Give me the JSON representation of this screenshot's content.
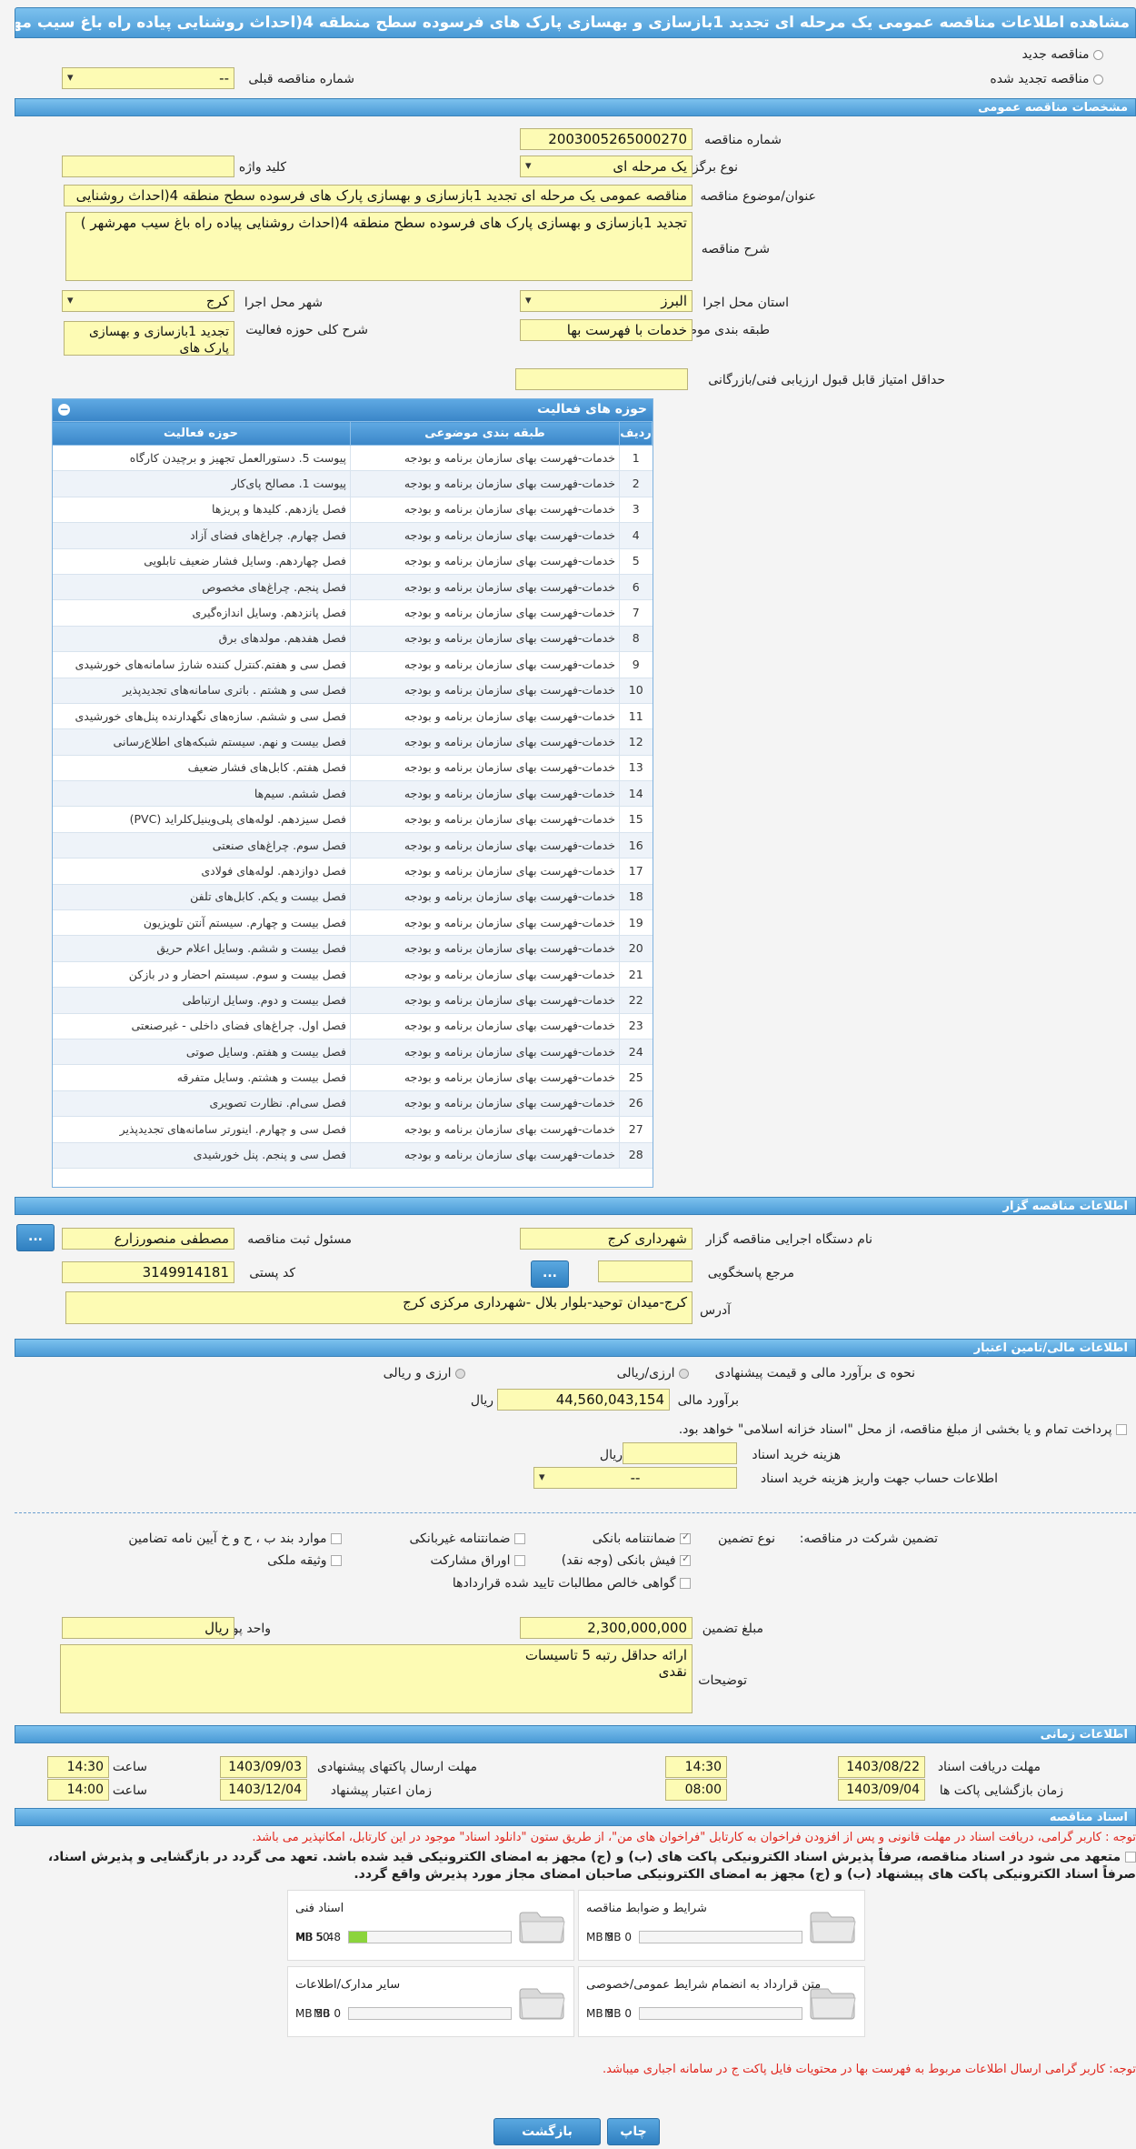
{
  "header": {
    "title": "مشاهده اطلاعات مناقصه عمومی یک مرحله ای تجدید 1بازسازی و بهسازی پارک های فرسوده سطح منطقه 4(احداث روشنایی پیاده راه باغ سیب مهرشهر )"
  },
  "top": {
    "new_tender": "مناقصه جدید",
    "renewed_tender": "مناقصه تجدید شده",
    "prev_number_label": "شماره مناقصه قبلی",
    "prev_number_value": "--"
  },
  "general": {
    "section_title": "مشخصات مناقصه عمومی",
    "number_label": "شماره مناقصه",
    "number_value": "2003005265000270",
    "type_label": "نوع برگزاری",
    "type_value": "یک مرحله ای",
    "keyword_label": "کلید واژه",
    "keyword_value": "",
    "subject_label": "عنوان/موضوع مناقصه",
    "subject_value": "مناقصه عمومی یک مرحله ای تجدید 1بازسازی و بهسازی پارک های فرسوده سطح منطقه 4(احداث روشنایی",
    "desc_label": "شرح مناقصه",
    "desc_value": "تجدید 1بازسازی و بهسازی پارک های فرسوده سطح منطقه 4(احداث روشنایی پیاده راه باغ سیب مهرشهر )",
    "province_label": "استان محل اجرا",
    "province_value": "البرز",
    "city_label": "شهر محل اجرا",
    "city_value": "کرج",
    "category_label": "طبقه بندی موضوعی",
    "category_value": "خدمات با فهرست بها",
    "activity_desc_label": "شرح کلی حوزه فعالیت",
    "activity_desc_value": "تجدید 1بازسازی و بهسازی پارک های",
    "min_score_label": "حداقل امتیاز قابل قبول ارزیابی فنی/بازرگانی",
    "min_score_value": ""
  },
  "activities": {
    "title": "حوزه های فعالیت",
    "headers": [
      "ردیف",
      "طبقه بندی موضوعی",
      "حوزه فعالیت"
    ],
    "rows": [
      [
        "1",
        "خدمات-فهرست بهای سازمان برنامه و بودجه",
        "پیوست 5. دستورالعمل تجهیز و برچیدن کارگاه"
      ],
      [
        "2",
        "خدمات-فهرست بهای سازمان برنامه و بودجه",
        "پیوست 1. مصالح پای‌کار"
      ],
      [
        "3",
        "خدمات-فهرست بهای سازمان برنامه و بودجه",
        "فصل یازدهم. کلیدها و پریزها"
      ],
      [
        "4",
        "خدمات-فهرست بهای سازمان برنامه و بودجه",
        "فصل چهارم. چراغ‌های فضای آزاد"
      ],
      [
        "5",
        "خدمات-فهرست بهای سازمان برنامه و بودجه",
        "فصل چهاردهم. وسایل فشار ضعیف تابلویی"
      ],
      [
        "6",
        "خدمات-فهرست بهای سازمان برنامه و بودجه",
        "فصل پنجم. چراغ‌های مخصوص"
      ],
      [
        "7",
        "خدمات-فهرست بهای سازمان برنامه و بودجه",
        "فصل پانزدهم. وسایل اندازه‌گیری"
      ],
      [
        "8",
        "خدمات-فهرست بهای سازمان برنامه و بودجه",
        "فصل هفدهم. مولدهای برق"
      ],
      [
        "9",
        "خدمات-فهرست بهای سازمان برنامه و بودجه",
        "فصل سی و هفتم.کنترل کننده شارژ سامانه‌های خورشیدی"
      ],
      [
        "10",
        "خدمات-فهرست بهای سازمان برنامه و بودجه",
        "فصل سی و هشتم . باتری سامانه‌های تجدیدپذیر"
      ],
      [
        "11",
        "خدمات-فهرست بهای سازمان برنامه و بودجه",
        "فصل سی و ششم. سازه‌های نگهدارنده پنل‌های خورشیدی"
      ],
      [
        "12",
        "خدمات-فهرست بهای سازمان برنامه و بودجه",
        "فصل بیست و نهم. سیستم شبکه‌های اطلاع‌رسانی"
      ],
      [
        "13",
        "خدمات-فهرست بهای سازمان برنامه و بودجه",
        "فصل هفتم. کابل‌های فشار ضعیف"
      ],
      [
        "14",
        "خدمات-فهرست بهای سازمان برنامه و بودجه",
        "فصل ششم. سیم‌ها"
      ],
      [
        "15",
        "خدمات-فهرست بهای سازمان برنامه و بودجه",
        "فصل سیزدهم. لوله‌های پلی‌وینیل‌کلراید (PVC)"
      ],
      [
        "16",
        "خدمات-فهرست بهای سازمان برنامه و بودجه",
        "فصل سوم. چراغ‌های صنعتی"
      ],
      [
        "17",
        "خدمات-فهرست بهای سازمان برنامه و بودجه",
        "فصل دوازدهم. لوله‌های فولادی"
      ],
      [
        "18",
        "خدمات-فهرست بهای سازمان برنامه و بودجه",
        "فصل بیست و یکم. کابل‌های تلفن"
      ],
      [
        "19",
        "خدمات-فهرست بهای سازمان برنامه و بودجه",
        "فصل بیست و چهارم. سیستم آنتن تلویزیون"
      ],
      [
        "20",
        "خدمات-فهرست بهای سازمان برنامه و بودجه",
        "فصل بیست و ششم. وسایل اعلام حریق"
      ],
      [
        "21",
        "خدمات-فهرست بهای سازمان برنامه و بودجه",
        "فصل بیست و سوم. سیستم احضار و در بازکن"
      ],
      [
        "22",
        "خدمات-فهرست بهای سازمان برنامه و بودجه",
        "فصل بیست و دوم. وسایل ارتباطی"
      ],
      [
        "23",
        "خدمات-فهرست بهای سازمان برنامه و بودجه",
        "فصل اول. چراغ‌های فضای داخلی - غیرصنعتی"
      ],
      [
        "24",
        "خدمات-فهرست بهای سازمان برنامه و بودجه",
        "فصل بیست و هفتم. وسایل صوتی"
      ],
      [
        "25",
        "خدمات-فهرست بهای سازمان برنامه و بودجه",
        "فصل بیست و هشتم. وسایل متفرقه"
      ],
      [
        "26",
        "خدمات-فهرست بهای سازمان برنامه و بودجه",
        "فصل سی‌ام. نظارت تصویری"
      ],
      [
        "27",
        "خدمات-فهرست بهای سازمان برنامه و بودجه",
        "فصل سی و چهارم. اینورتر سامانه‌های تجدیدپذیر"
      ],
      [
        "28",
        "خدمات-فهرست بهای سازمان برنامه و بودجه",
        "فصل سی و پنجم. پنل خورشیدی"
      ]
    ]
  },
  "organizer": {
    "section_title": "اطلاعات مناقصه گزار",
    "org_label": "نام دستگاه اجرایی مناقصه گزار",
    "org_value": "شهرداری کرج",
    "registrar_label": "مسئول ثبت مناقصه",
    "registrar_value": "مصطفی منصورزارع",
    "ref_label": "مرجع پاسخگویی",
    "ref_value": "",
    "postal_label": "کد پستی",
    "postal_value": "3149914181",
    "address_label": "آدرس",
    "address_value": "کرج-میدان توحید-بلوار بلال -شهرداری مرکزی کرج",
    "btn_more": "..."
  },
  "financial": {
    "section_title": "اطلاعات مالی/تامین اعتبار",
    "estimate_method_label": "نحوه ی برآورد مالی و قیمت پیشنهادی",
    "opt_rial_fx": "ارزی/ریالی",
    "opt_fx_and_rial": "ارزی و ریالی",
    "estimate_label": "برآورد مالی",
    "estimate_value": "44,560,043,154",
    "currency": "ریال",
    "islamic_note": "پرداخت تمام و یا بخشی از مبلغ مناقصه، از محل \"اسناد خزانه اسلامی\" خواهد بود.",
    "doc_fee_label": "هزینه خرید اسناد",
    "doc_fee_unit": "ریال",
    "doc_fee_value": "",
    "account_label": "اطلاعات حساب جهت واریز هزینه خرید اسناد",
    "account_value": "--"
  },
  "guarantee": {
    "participation_label": "تضمین شرکت در مناقصه:",
    "type_label": "نوع تضمین",
    "options": {
      "bank_guarantee": "ضمانتنامه بانکی",
      "non_bank_guarantee": "ضمانتنامه غیربانکی",
      "clause_items": "موارد بند ب ، ح و خ آیین نامه تضامین",
      "bank_receipt": "فیش بانکی (وجه نقد)",
      "bonds": "اوراق مشارکت",
      "property": "وثیقه ملکی",
      "receivables": "گواهی خالص مطالبات تایید شده قراردادها"
    },
    "amount_label": "مبلغ تضمین",
    "amount_value": "2,300,000,000",
    "currency_label": "واحد پول",
    "currency_value": "ریال",
    "notes_label": "توضیحات",
    "notes_value": "ارائه حداقل رتبه 5 تاسیسات\nنقدی"
  },
  "timing": {
    "section_title": "اطلاعات زمانی",
    "receive_label": "مهلت دریافت اسناد",
    "receive_date": "1403/08/22",
    "receive_time": "14:30",
    "submit_label": "مهلت ارسال پاکتهای پیشنهادی",
    "submit_date": "1403/09/03",
    "submit_time": "14:30",
    "open_label": "زمان بازگشایی پاکت ها",
    "open_date": "1403/09/04",
    "open_time": "08:00",
    "validity_label": "زمان اعتبار پیشنهاد",
    "validity_date": "1403/12/04",
    "validity_time": "14:00",
    "time_label": "ساعت"
  },
  "documents": {
    "section_title": "اسناد مناقصه",
    "notice_red": "توجه : کاربر گرامی، دریافت اسناد در مهلت قانونی و پس از افزودن فراخوان به کارتابل \"فراخوان های من\"، از طریق ستون \"دانلود اسناد\" موجود در این کارتابل، امکانپذیر می باشد.",
    "commit_1": "متعهد می شود در اسناد مناقصه، صرفاً پذیرش اسناد الکترونیکی پاکت های (ب) و (ج) مجهز به امضای الکترونیکی قید شده باشد. تعهد می گردد در بازگشایی و پذیرش اسناد،",
    "commit_2": "صرفاً اسناد الکترونیکی پاکت های پیشنهاد (ب) و (ج) مجهز به امضای الکترونیکی صاحبان امضای مجاز مورد پذیرش واقع گردد.",
    "items": [
      {
        "name": "شرایط و ضوابط مناقصه",
        "used": "0 MB",
        "max": "5 MB",
        "fill": 0
      },
      {
        "name": "اسناد فنی",
        "used": "5.48 MB",
        "max": "50 MB",
        "fill": 0.11
      },
      {
        "name": "متن قرارداد به انضمام شرایط عمومی/خصوصی",
        "used": "0 MB",
        "max": "5 MB",
        "fill": 0
      },
      {
        "name": "سایر مدارک/اطلاعات",
        "used": "0 MB",
        "max": "50 MB",
        "fill": 0
      }
    ],
    "footer_note": "توجه: کاربر گرامی ارسال اطلاعات مربوط به فهرست بها در محتویات فایل پاکت ج در سامانه اجباری میباشد."
  },
  "buttons": {
    "print": "چاپ",
    "back": "بازگشت"
  },
  "colors": {
    "header": "#4a9ad6",
    "field": "#fdfbb4",
    "warning": "#e0251c"
  }
}
